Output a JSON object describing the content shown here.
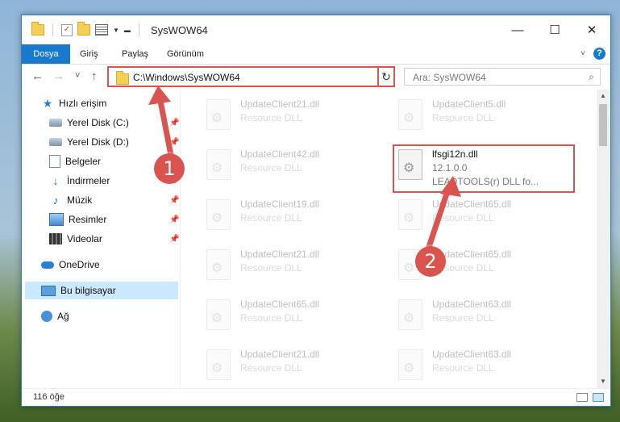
{
  "window": {
    "title": "SysWOW64"
  },
  "ribbon": {
    "tabs": [
      "Dosya",
      "Giriş",
      "Paylaş",
      "Görünüm"
    ],
    "help": "?"
  },
  "nav": {
    "back": "←",
    "forward": "→",
    "recent": "˅",
    "up": "↑"
  },
  "address": {
    "path": "C:\\Windows\\SysWOW64",
    "dropdown": "˅",
    "refresh": "↻"
  },
  "search": {
    "placeholder": "Ara: SysWOW64",
    "icon": "search-icon"
  },
  "sidebar": {
    "items": [
      {
        "label": "Hızlı erişim",
        "icon": "star-icon"
      },
      {
        "label": "Yerel Disk (C:)",
        "icon": "disk-icon",
        "pinned": true
      },
      {
        "label": "Yerel Disk (D:)",
        "icon": "disk-icon",
        "pinned": true
      },
      {
        "label": "Belgeler",
        "icon": "document-icon",
        "pinned": true
      },
      {
        "label": "İndirmeler",
        "icon": "download-icon",
        "pinned": true
      },
      {
        "label": "Müzik",
        "icon": "music-icon",
        "pinned": true
      },
      {
        "label": "Resimler",
        "icon": "pictures-icon",
        "pinned": true
      },
      {
        "label": "Videolar",
        "icon": "video-icon",
        "pinned": true
      },
      {
        "label": "OneDrive",
        "icon": "cloud-icon"
      },
      {
        "label": "Bu bilgisayar",
        "icon": "computer-icon",
        "selected": true
      },
      {
        "label": "Ağ",
        "icon": "network-icon"
      }
    ]
  },
  "files": {
    "type_label": "Resource DLL",
    "left": [
      "UpdateClient21.dll",
      "UpdateClient42.dll",
      "UpdateClient19.dll",
      "UpdateClient21.dll",
      "UpdateClient65.dll",
      "UpdateClient21.dll"
    ],
    "right": [
      "UpdateClient5.dll",
      "UpdateClient65.dll",
      "UpdateClient65.dll",
      "UpdateClient63.dll",
      "UpdateClient63.dll"
    ],
    "highlighted": {
      "name": "lfsgi12n.dll",
      "version": "12.1.0.0",
      "description": "LEADTOOLS(r) DLL fo..."
    }
  },
  "status": {
    "count": "116 öğe"
  },
  "annotations": {
    "badge1": "1",
    "badge2": "2",
    "color": "#d9534f"
  }
}
